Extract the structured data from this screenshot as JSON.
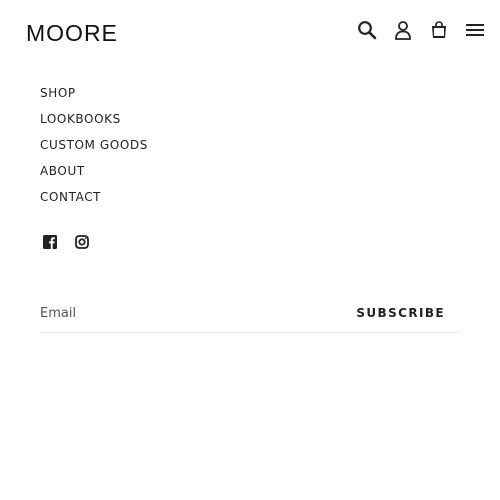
{
  "brand": {
    "name": "MOORE"
  },
  "header": {
    "icons": [
      {
        "name": "search-icon",
        "label": "Search"
      },
      {
        "name": "user-icon",
        "label": "Log in"
      },
      {
        "name": "cart-icon",
        "label": "Cart"
      },
      {
        "name": "menu-icon",
        "label": "Menu"
      }
    ]
  },
  "nav": {
    "items": [
      {
        "label": "SHOP"
      },
      {
        "label": "LOOKBOOKS"
      },
      {
        "label": "CUSTOM GOODS"
      },
      {
        "label": "ABOUT"
      },
      {
        "label": "CONTACT"
      }
    ]
  },
  "social": {
    "icons": [
      {
        "name": "facebook-icon"
      },
      {
        "name": "instagram-icon"
      }
    ]
  },
  "newsletter": {
    "email_placeholder": "Email",
    "email_value": "",
    "subscribe_label": "SUBSCRIBE"
  }
}
